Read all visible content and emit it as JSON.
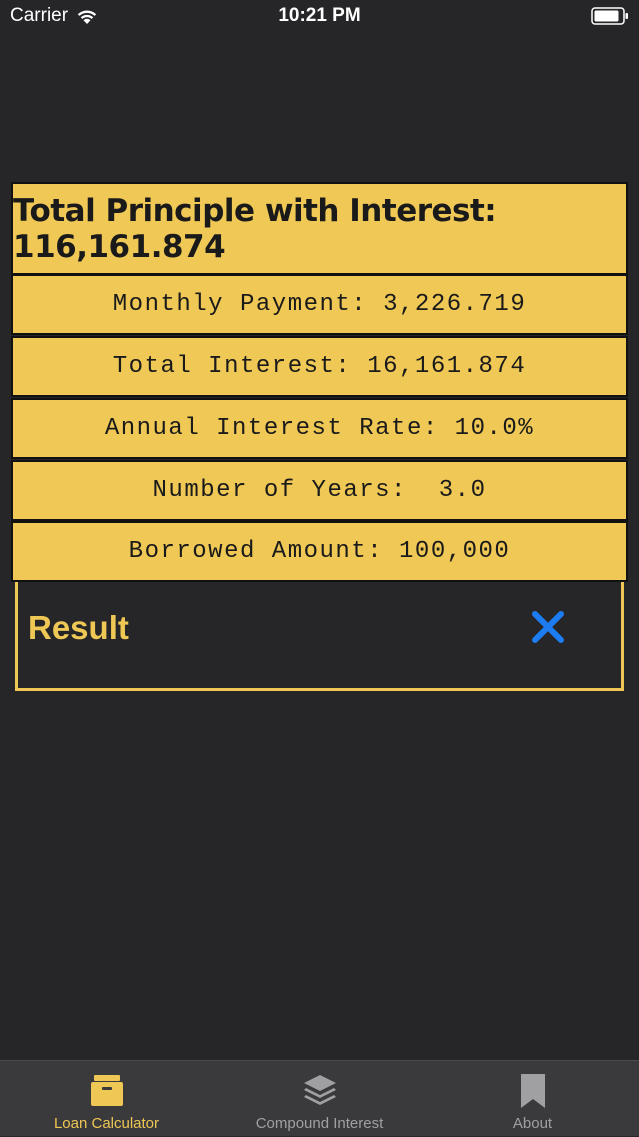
{
  "status_bar": {
    "carrier": "Carrier",
    "time": "10:21 PM"
  },
  "results": {
    "total_principle": "Total Principle with Interest: 116,161.874",
    "monthly_payment": "Monthly Payment: 3,226.719",
    "total_interest": "Total Interest: 16,161.874",
    "annual_rate": "Annual Interest Rate: 10.0%",
    "years": "Number of Years:  3.0",
    "borrowed": "Borrowed Amount: 100,000"
  },
  "panel": {
    "title": "Result"
  },
  "tabs": [
    {
      "label": "Loan Calculator",
      "icon": "archive-box-icon",
      "active": true
    },
    {
      "label": "Compound Interest",
      "icon": "layers-icon",
      "active": false
    },
    {
      "label": "About",
      "icon": "bookmark-icon",
      "active": false
    }
  ],
  "colors": {
    "background": "#262528",
    "accent": "#efc755",
    "card": "#efc855",
    "close": "#1e7cf2",
    "tab_bar": "#3a3a3c"
  }
}
